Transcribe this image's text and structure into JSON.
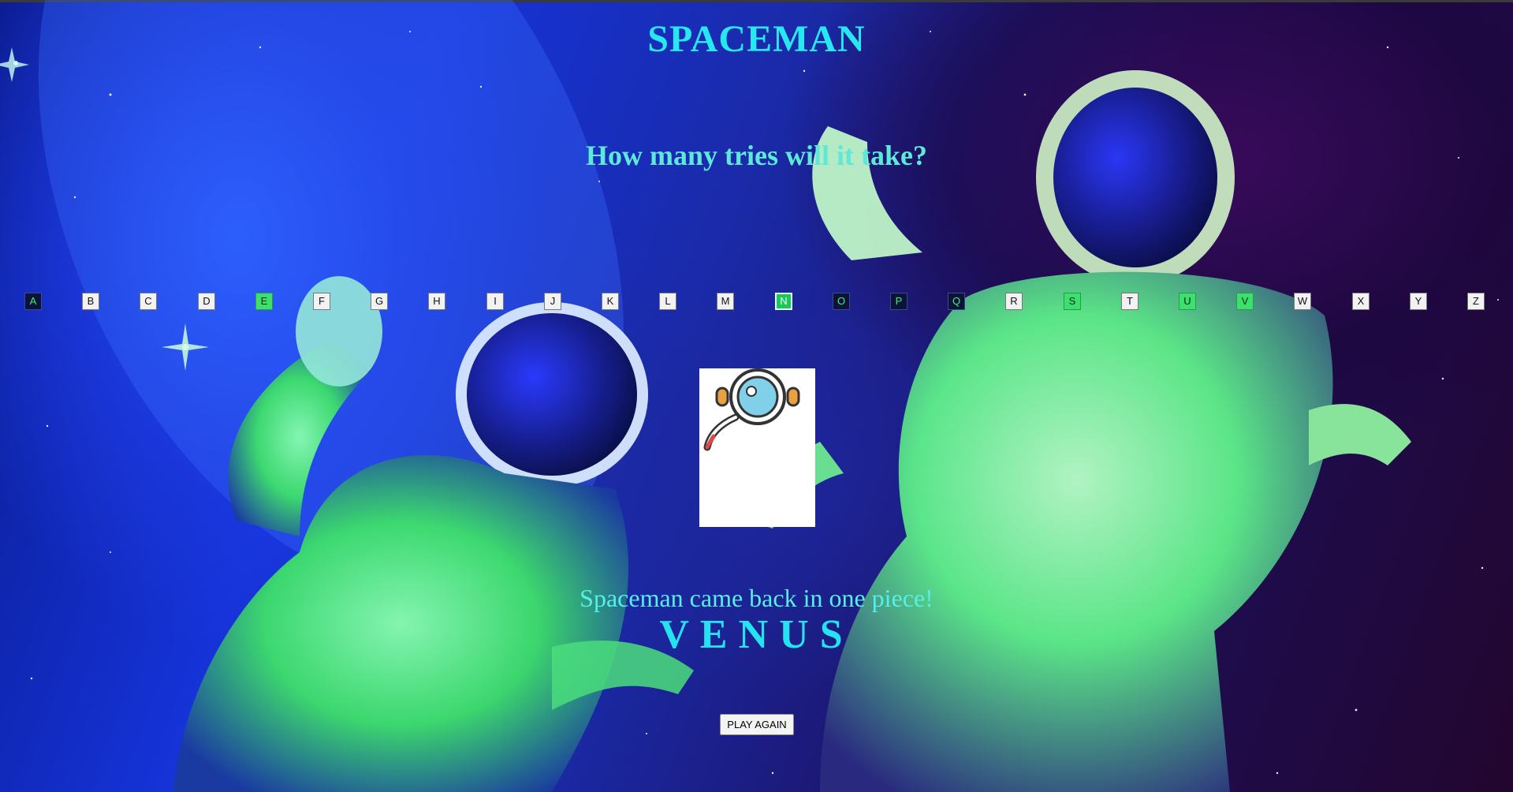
{
  "game": {
    "title": "SPACEMAN",
    "subtitle": "How many tries will it take?",
    "result_message": "Spaceman came back in one piece!",
    "word": "VENUS",
    "play_again_label": "PLAY AGAIN"
  },
  "keyboard": {
    "letters": [
      {
        "label": "A",
        "state": "guessed-wrong"
      },
      {
        "label": "B",
        "state": "unused"
      },
      {
        "label": "C",
        "state": "unused"
      },
      {
        "label": "D",
        "state": "unused"
      },
      {
        "label": "E",
        "state": "guessed-correct"
      },
      {
        "label": "F",
        "state": "unused"
      },
      {
        "label": "G",
        "state": "unused"
      },
      {
        "label": "H",
        "state": "unused"
      },
      {
        "label": "I",
        "state": "unused"
      },
      {
        "label": "J",
        "state": "unused"
      },
      {
        "label": "K",
        "state": "unused"
      },
      {
        "label": "L",
        "state": "unused"
      },
      {
        "label": "M",
        "state": "unused"
      },
      {
        "label": "N",
        "state": "guessed-correct-focused"
      },
      {
        "label": "O",
        "state": "guessed-wrong"
      },
      {
        "label": "P",
        "state": "guessed-wrong"
      },
      {
        "label": "Q",
        "state": "guessed-wrong"
      },
      {
        "label": "R",
        "state": "unused"
      },
      {
        "label": "S",
        "state": "guessed-correct"
      },
      {
        "label": "T",
        "state": "unused"
      },
      {
        "label": "U",
        "state": "guessed-correct"
      },
      {
        "label": "V",
        "state": "guessed-correct"
      },
      {
        "label": "W",
        "state": "unused"
      },
      {
        "label": "X",
        "state": "unused"
      },
      {
        "label": "Y",
        "state": "unused"
      },
      {
        "label": "Z",
        "state": "unused"
      }
    ]
  },
  "colors": {
    "title": "#27e8f0",
    "subtitle": "#5ee8d8",
    "correct_guess": "#3ddf6f",
    "wrong_guess": "#0c1238"
  },
  "icons": {
    "spaceman": "astronaut-helmet-icon"
  }
}
